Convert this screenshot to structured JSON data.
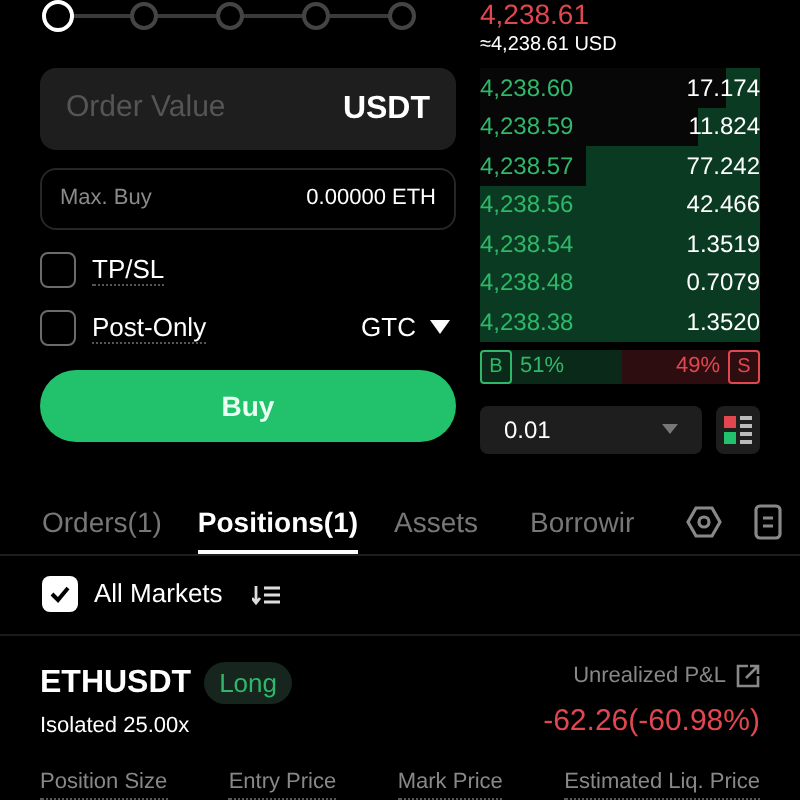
{
  "slider": {
    "level": 0
  },
  "order_form": {
    "order_value": {
      "placeholder": "Order Value",
      "unit": "USDT"
    },
    "max_buy": {
      "label": "Max. Buy",
      "value": "0.00000 ETH"
    },
    "options": [
      {
        "label": "TP/SL",
        "checked": false
      },
      {
        "label": "Post-Only",
        "checked": false
      }
    ],
    "time_in_force": "GTC",
    "submit": "Buy"
  },
  "order_book": {
    "last_price": "4,238.61",
    "last_price_usd": "≈4,238.61 USD",
    "bids": [
      {
        "price": "4,238.60",
        "size": "17.174",
        "level": 0.12
      },
      {
        "price": "4,238.59",
        "size": "11.824",
        "level": 0.22
      },
      {
        "price": "4,238.57",
        "size": "77.242",
        "level": 0.62
      },
      {
        "price": "4,238.56",
        "size": "42.466",
        "level": 1
      },
      {
        "price": "4,238.54",
        "size": "1.3519",
        "level": 1
      },
      {
        "price": "4,238.48",
        "size": "0.7079",
        "level": 1
      },
      {
        "price": "4,238.38",
        "size": "1.3520",
        "level": 1
      }
    ],
    "ratio": {
      "buy_label": "B",
      "buy": "51%",
      "sell": "49%",
      "sell_label": "S",
      "level": 0.51
    },
    "precision": "0.01"
  },
  "tabs": [
    {
      "label": "Orders(1)",
      "selected": false
    },
    {
      "label": "Positions(1)",
      "selected": true
    },
    {
      "label": "Assets",
      "selected": false
    },
    {
      "label": "Borrowir",
      "selected": false
    }
  ],
  "filter": {
    "label": "All Markets",
    "checked": true
  },
  "position": {
    "symbol": "ETHUSDT",
    "side": "Long",
    "margin": "Isolated 25.00x",
    "pnl_label": "Unrealized P&L",
    "pnl": "-62.26(-60.98%)",
    "columns": [
      "Position Size",
      "Entry Price",
      "Mark Price",
      "Estimated Liq. Price"
    ]
  }
}
